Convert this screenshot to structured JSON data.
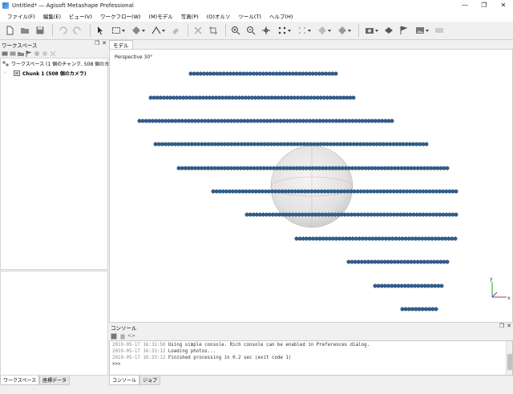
{
  "window": {
    "title": "Untitled* — Agisoft Metashape Professional",
    "controls": [
      "—",
      "❐",
      "✕"
    ]
  },
  "menu": [
    "ファイル(F)",
    "編集(E)",
    "ビュー(V)",
    "ワークフロー(W)",
    "(M)モデル",
    "写真(P)",
    "(O)オルソ",
    "ツール(T)",
    "ヘルプ(H)"
  ],
  "toolbar_icons": [
    "new-icon",
    "open-icon",
    "save-icon",
    "undo-icon",
    "redo-icon",
    "select-icon",
    "rect-select-icon",
    "navigate-icon",
    "ruler-icon",
    "delete-icon",
    "crop-icon",
    "zoom-in-icon",
    "zoom-out-icon",
    "move-icon",
    "point-cloud-icon",
    "grid-icon",
    "mesh-icon",
    "texture-icon",
    "camera-icon",
    "show-cameras-icon",
    "marker-icon",
    "image-icon"
  ],
  "workspace": {
    "header": "ワークスペース",
    "root_label": "ワークスペース (1 個のチャンク, 508 個のカメラ)",
    "chunk_label": "Chunk 1 (508 個のカメラ)",
    "tabs": [
      "ワークスペース",
      "座標データ"
    ]
  },
  "model": {
    "tab": "モデル",
    "view_label": "Perspective 30°",
    "axis_y": "y",
    "axis_x": "x",
    "camera_color": "#2e5f8f"
  },
  "console": {
    "header": "コンソール",
    "lines": [
      {
        "ts": "2019-05-17 16:32:50",
        "msg": "Using simple console. Rich console can be enabled in Preferences dialog."
      },
      {
        "ts": "2019-05-17 16:33:12",
        "msg": "Loading photos..."
      },
      {
        "ts": "2019-05-17 16:33:12",
        "msg": "Finished processing in 0.2 sec (exit code 1)"
      },
      {
        "ts": "",
        "msg": ">>>"
      }
    ],
    "tabs": [
      "コンソール",
      "ジョブ"
    ]
  }
}
